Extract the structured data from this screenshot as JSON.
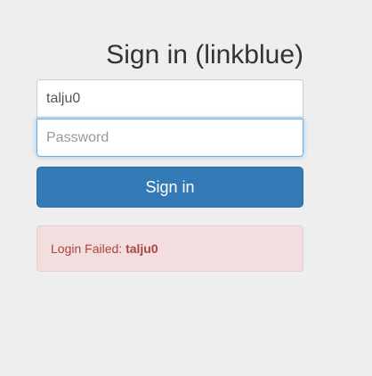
{
  "login": {
    "heading": "Sign in (linkblue)",
    "username_value": "talju0",
    "password_placeholder": "Password",
    "submit_label": "Sign in"
  },
  "alert": {
    "prefix": "Login Failed: ",
    "username": "talju0"
  },
  "colors": {
    "background": "#eeeeee",
    "primary_button": "#337ab7",
    "alert_background": "#f2dede",
    "alert_text": "#a94442",
    "focus_border": "#66afe9"
  }
}
